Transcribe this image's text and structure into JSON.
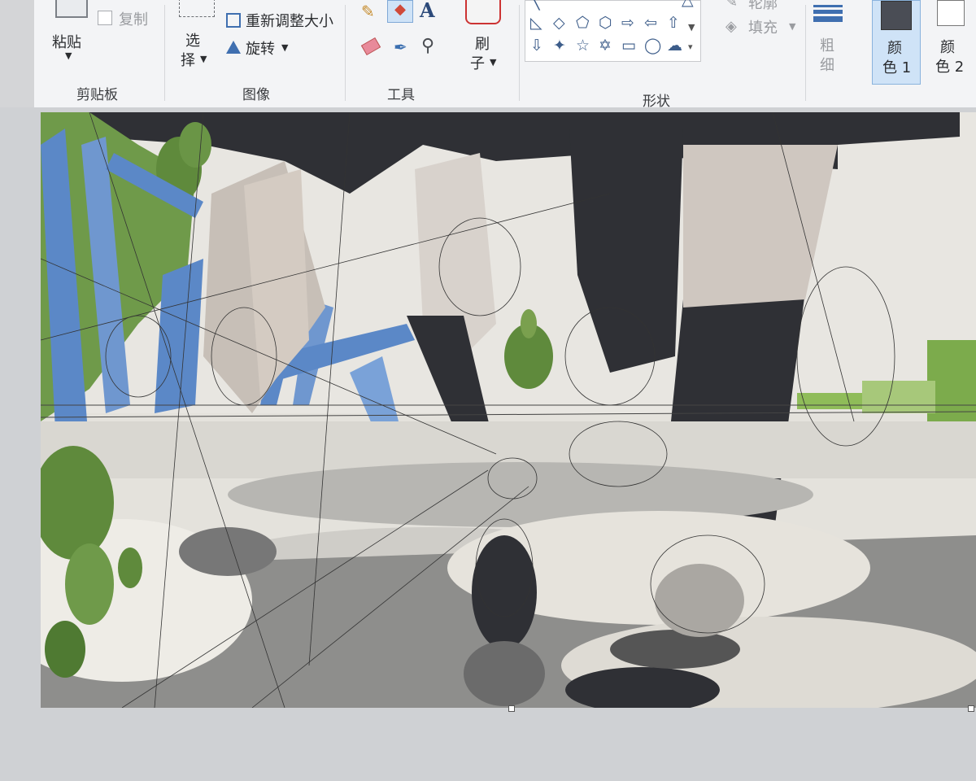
{
  "ribbon": {
    "clipboard": {
      "paste_label": "粘贴",
      "copy_label": "复制",
      "group_label": "剪贴板"
    },
    "image": {
      "select_label_1": "选",
      "select_label_2": "择",
      "resize_label": "重新调整大小",
      "rotate_label": "旋转",
      "group_label": "图像"
    },
    "tools": {
      "group_label": "工具",
      "text_glyph": "A"
    },
    "brushes": {
      "label_1": "刷",
      "label_2": "子"
    },
    "shapes": {
      "group_label": "形状",
      "outline_label": "轮廓",
      "fill_label": "填充"
    },
    "size": {
      "label_1": "粗",
      "label_2": "细"
    },
    "colors": {
      "color1_label_1": "颜",
      "color1_label_2": "色 1",
      "color2_label_1": "颜",
      "color2_label_2": "色 2",
      "color1_value": "#4a4d55",
      "color2_value": "#ffffff"
    }
  },
  "palette": {
    "ribbon_bg": "#f3f4f6",
    "canvas_bg": "#cfd1d4",
    "accent_green": "#5f8a3c",
    "accent_blue": "#5b88c7",
    "dark_fill": "#2f3035"
  }
}
